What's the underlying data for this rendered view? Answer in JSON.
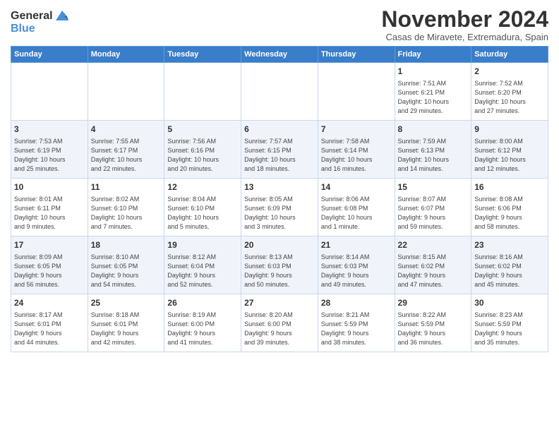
{
  "header": {
    "logo_line1": "General",
    "logo_line2": "Blue",
    "month_title": "November 2024",
    "subtitle": "Casas de Miravete, Extremadura, Spain"
  },
  "weekdays": [
    "Sunday",
    "Monday",
    "Tuesday",
    "Wednesday",
    "Thursday",
    "Friday",
    "Saturday"
  ],
  "weeks": [
    [
      {
        "day": "",
        "info": ""
      },
      {
        "day": "",
        "info": ""
      },
      {
        "day": "",
        "info": ""
      },
      {
        "day": "",
        "info": ""
      },
      {
        "day": "",
        "info": ""
      },
      {
        "day": "1",
        "info": "Sunrise: 7:51 AM\nSunset: 6:21 PM\nDaylight: 10 hours\nand 29 minutes."
      },
      {
        "day": "2",
        "info": "Sunrise: 7:52 AM\nSunset: 6:20 PM\nDaylight: 10 hours\nand 27 minutes."
      }
    ],
    [
      {
        "day": "3",
        "info": "Sunrise: 7:53 AM\nSunset: 6:19 PM\nDaylight: 10 hours\nand 25 minutes."
      },
      {
        "day": "4",
        "info": "Sunrise: 7:55 AM\nSunset: 6:17 PM\nDaylight: 10 hours\nand 22 minutes."
      },
      {
        "day": "5",
        "info": "Sunrise: 7:56 AM\nSunset: 6:16 PM\nDaylight: 10 hours\nand 20 minutes."
      },
      {
        "day": "6",
        "info": "Sunrise: 7:57 AM\nSunset: 6:15 PM\nDaylight: 10 hours\nand 18 minutes."
      },
      {
        "day": "7",
        "info": "Sunrise: 7:58 AM\nSunset: 6:14 PM\nDaylight: 10 hours\nand 16 minutes."
      },
      {
        "day": "8",
        "info": "Sunrise: 7:59 AM\nSunset: 6:13 PM\nDaylight: 10 hours\nand 14 minutes."
      },
      {
        "day": "9",
        "info": "Sunrise: 8:00 AM\nSunset: 6:12 PM\nDaylight: 10 hours\nand 12 minutes."
      }
    ],
    [
      {
        "day": "10",
        "info": "Sunrise: 8:01 AM\nSunset: 6:11 PM\nDaylight: 10 hours\nand 9 minutes."
      },
      {
        "day": "11",
        "info": "Sunrise: 8:02 AM\nSunset: 6:10 PM\nDaylight: 10 hours\nand 7 minutes."
      },
      {
        "day": "12",
        "info": "Sunrise: 8:04 AM\nSunset: 6:10 PM\nDaylight: 10 hours\nand 5 minutes."
      },
      {
        "day": "13",
        "info": "Sunrise: 8:05 AM\nSunset: 6:09 PM\nDaylight: 10 hours\nand 3 minutes."
      },
      {
        "day": "14",
        "info": "Sunrise: 8:06 AM\nSunset: 6:08 PM\nDaylight: 10 hours\nand 1 minute."
      },
      {
        "day": "15",
        "info": "Sunrise: 8:07 AM\nSunset: 6:07 PM\nDaylight: 9 hours\nand 59 minutes."
      },
      {
        "day": "16",
        "info": "Sunrise: 8:08 AM\nSunset: 6:06 PM\nDaylight: 9 hours\nand 58 minutes."
      }
    ],
    [
      {
        "day": "17",
        "info": "Sunrise: 8:09 AM\nSunset: 6:05 PM\nDaylight: 9 hours\nand 56 minutes."
      },
      {
        "day": "18",
        "info": "Sunrise: 8:10 AM\nSunset: 6:05 PM\nDaylight: 9 hours\nand 54 minutes."
      },
      {
        "day": "19",
        "info": "Sunrise: 8:12 AM\nSunset: 6:04 PM\nDaylight: 9 hours\nand 52 minutes."
      },
      {
        "day": "20",
        "info": "Sunrise: 8:13 AM\nSunset: 6:03 PM\nDaylight: 9 hours\nand 50 minutes."
      },
      {
        "day": "21",
        "info": "Sunrise: 8:14 AM\nSunset: 6:03 PM\nDaylight: 9 hours\nand 49 minutes."
      },
      {
        "day": "22",
        "info": "Sunrise: 8:15 AM\nSunset: 6:02 PM\nDaylight: 9 hours\nand 47 minutes."
      },
      {
        "day": "23",
        "info": "Sunrise: 8:16 AM\nSunset: 6:02 PM\nDaylight: 9 hours\nand 45 minutes."
      }
    ],
    [
      {
        "day": "24",
        "info": "Sunrise: 8:17 AM\nSunset: 6:01 PM\nDaylight: 9 hours\nand 44 minutes."
      },
      {
        "day": "25",
        "info": "Sunrise: 8:18 AM\nSunset: 6:01 PM\nDaylight: 9 hours\nand 42 minutes."
      },
      {
        "day": "26",
        "info": "Sunrise: 8:19 AM\nSunset: 6:00 PM\nDaylight: 9 hours\nand 41 minutes."
      },
      {
        "day": "27",
        "info": "Sunrise: 8:20 AM\nSunset: 6:00 PM\nDaylight: 9 hours\nand 39 minutes."
      },
      {
        "day": "28",
        "info": "Sunrise: 8:21 AM\nSunset: 5:59 PM\nDaylight: 9 hours\nand 38 minutes."
      },
      {
        "day": "29",
        "info": "Sunrise: 8:22 AM\nSunset: 5:59 PM\nDaylight: 9 hours\nand 36 minutes."
      },
      {
        "day": "30",
        "info": "Sunrise: 8:23 AM\nSunset: 5:59 PM\nDaylight: 9 hours\nand 35 minutes."
      }
    ]
  ]
}
